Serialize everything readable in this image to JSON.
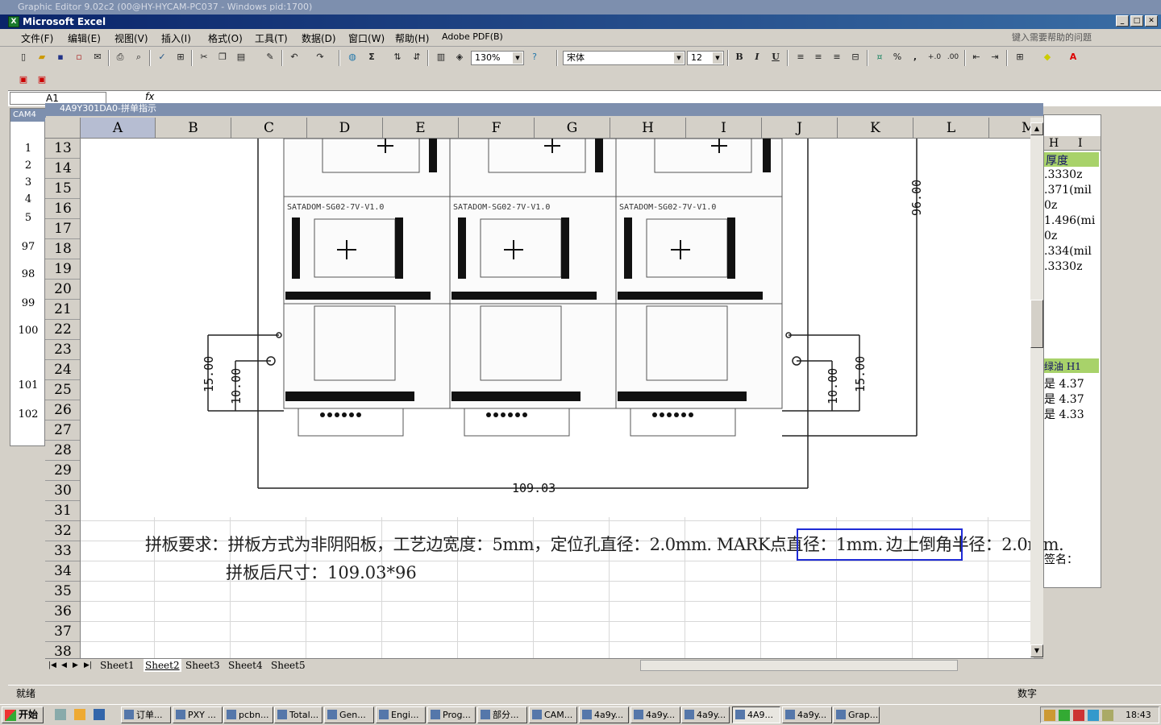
{
  "outer_window": {
    "title": "Graphic Editor 9.02c2 (00@HY-HYCAM-PC037 - Windows pid:1700)"
  },
  "excel_window": {
    "title": "Microsoft Excel"
  },
  "menu": {
    "items": [
      "文件(F)",
      "编辑(E)",
      "视图(V)",
      "插入(I)",
      "格式(O)",
      "工具(T)",
      "数据(D)",
      "窗口(W)",
      "帮助(H)",
      "Adobe PDF(B)"
    ],
    "help_placeholder": "键入需要帮助的问题"
  },
  "toolbar": {
    "zoom": "130%",
    "font": "宋体",
    "font_size": "12",
    "bold": "B",
    "italic": "I",
    "underline": "U",
    "percent": "%",
    "comma": ","
  },
  "formula_bar": {
    "cell_ref": "A1",
    "fx": "fx",
    "content": ""
  },
  "workbook": {
    "title": "4A9Y301DA0-拼单指示",
    "columns": [
      "A",
      "B",
      "C",
      "D",
      "E",
      "F",
      "G",
      "H",
      "I",
      "J",
      "K",
      "L",
      "M"
    ],
    "rows": [
      "13",
      "14",
      "15",
      "16",
      "17",
      "18",
      "19",
      "20",
      "21",
      "22",
      "23",
      "24",
      "25",
      "26",
      "27",
      "28",
      "29",
      "30",
      "31",
      "32",
      "33",
      "34",
      "35",
      "36",
      "37",
      "38"
    ],
    "sheets": [
      "Sheet1",
      "Sheet2",
      "Sheet3",
      "Sheet4",
      "Sheet5"
    ],
    "active_sheet": "Sheet2"
  },
  "drawing": {
    "board_labels": [
      "SATADOM-SG02-7V-V1.0",
      "SATADOM-SG02-7V-V1.0",
      "SATADOM-SG02-7V-V1.0"
    ],
    "dim_width": "109.03",
    "dim_height": "96.00",
    "dim_left_outer": "15.00",
    "dim_left_inner": "10.00",
    "dim_right_outer": "15.00",
    "dim_right_inner": "10.00"
  },
  "note": {
    "line1": "拼板要求：拼板方式为非阴阳板，工艺边宽度：5mm，定位孔直径：2.0mm. MARK点直径：1mm.",
    "highlight": "边上倒角半径：2.0mm.",
    "line2": "拼板后尺寸：109.03*96"
  },
  "bg_left_window": {
    "title": "CAM4",
    "rows": [
      "1",
      "2",
      "3",
      "4",
      "5",
      "97",
      "98",
      "99",
      "100",
      "101",
      "102"
    ]
  },
  "bg_right_window": {
    "col_h": "H",
    "col_i": "I",
    "header1": "厚度",
    "values": [
      ".3330z",
      ".371(mil",
      "0z",
      "1.496(mi",
      "0z",
      ".334(mil",
      ".3330z"
    ],
    "header2": "绿油 H1",
    "rows2": [
      "是  4.37",
      "是  4.37",
      "是  4.33"
    ],
    "footer": "签名："
  },
  "status": {
    "ready": "就绪",
    "num": "数字"
  },
  "taskbar": {
    "start": "开始",
    "tasks": [
      "订单...",
      "PXY ...",
      "pcbn...",
      "Total...",
      "Gen...",
      "Engi...",
      "Prog...",
      "部分...",
      "CAM...",
      "4a9y...",
      "4a9y...",
      "4a9y...",
      "4A9...",
      "4a9y...",
      "Grap..."
    ],
    "active_task": "4A9...",
    "clock": "18:43"
  }
}
